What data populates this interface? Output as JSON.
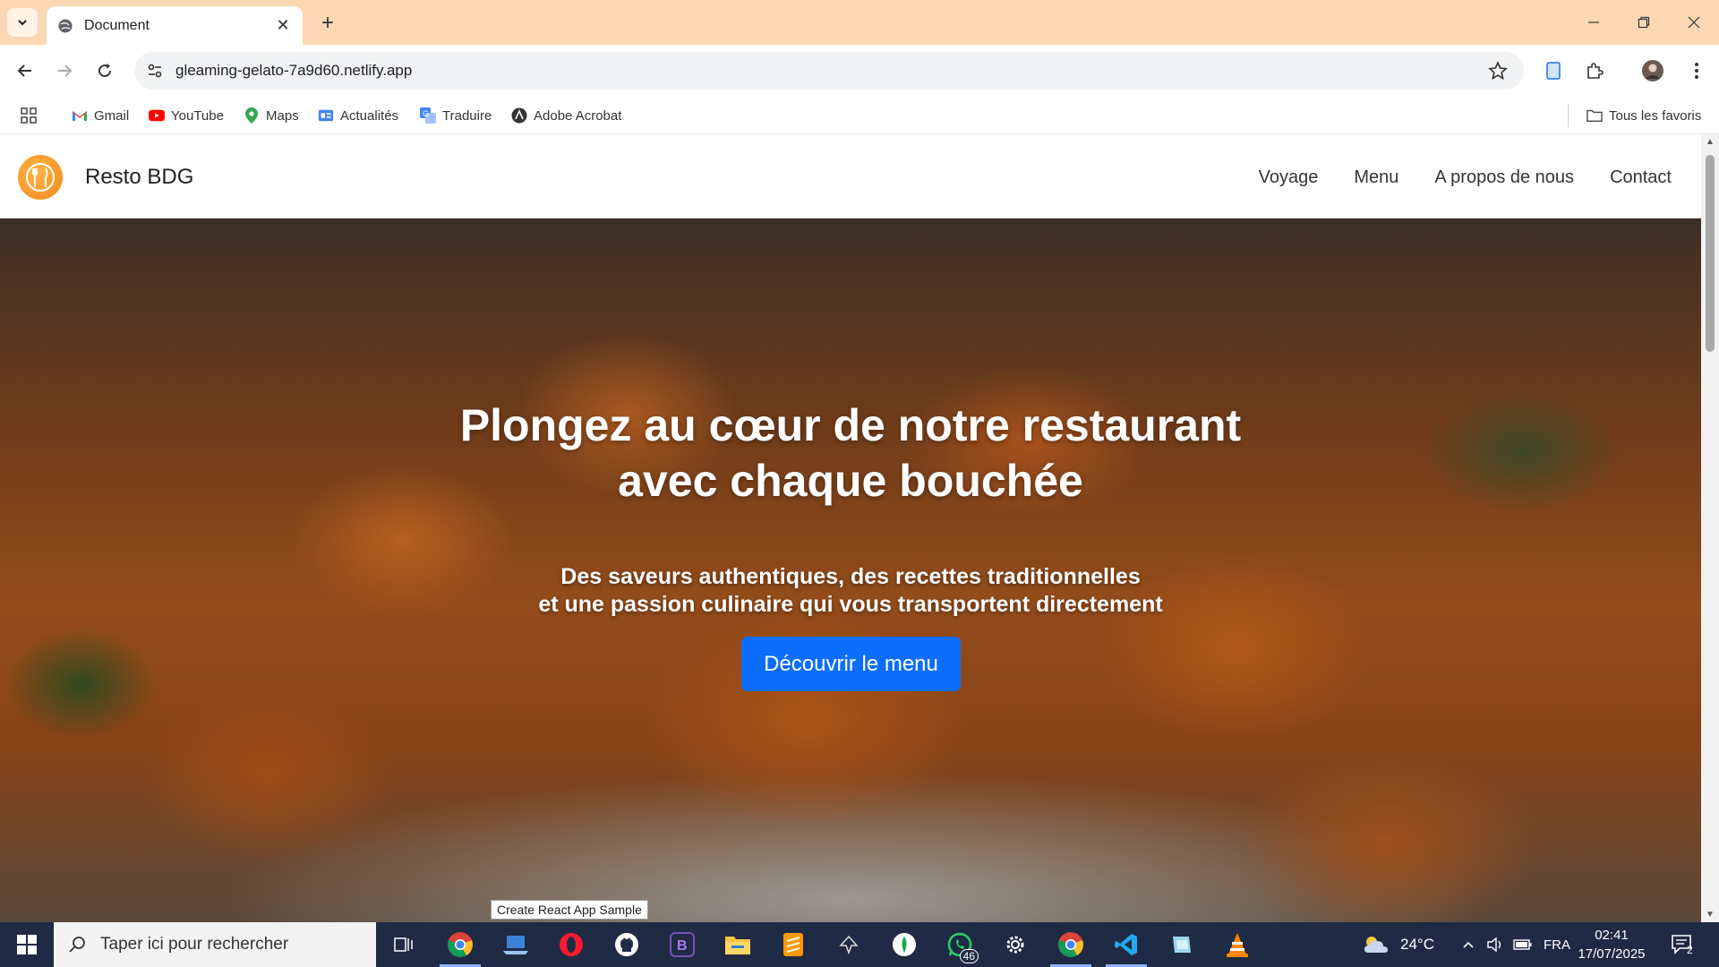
{
  "browser": {
    "tab_title": "Document",
    "url": "gleaming-gelato-7a9d60.netlify.app",
    "bookmarks": [
      {
        "label": "Gmail",
        "icon": "gmail-icon"
      },
      {
        "label": "YouTube",
        "icon": "youtube-icon"
      },
      {
        "label": "Maps",
        "icon": "maps-icon"
      },
      {
        "label": "Actualités",
        "icon": "news-icon"
      },
      {
        "label": "Traduire",
        "icon": "translate-icon"
      },
      {
        "label": "Adobe Acrobat",
        "icon": "acrobat-icon"
      }
    ],
    "all_bookmarks": "Tous les favoris",
    "colors": {
      "tabbar": "#fbd7b3",
      "omnibox": "#f1f3f4"
    }
  },
  "site": {
    "brand": "Resto BDG",
    "nav": [
      "Voyage",
      "Menu",
      "A propos de nous",
      "Contact"
    ],
    "hero": {
      "title_line1": "Plongez au cœur de notre restaurant",
      "title_line2": "avec chaque bouchée",
      "subtitle_line1": "Des saveurs authentiques, des recettes traditionnelles",
      "subtitle_line2": "et une passion culinaire qui vous transportent directement",
      "cta": "Découvrir le menu"
    },
    "colors": {
      "cta": "#0d6efd",
      "logo": "#f08a1b"
    }
  },
  "tooltip": "Create React App Sample",
  "taskbar": {
    "search_placeholder": "Taper ici pour rechercher",
    "whatsapp_badge": "46",
    "weather": "24°C",
    "language": "FRA",
    "time": "02:41",
    "date": "17/07/2025",
    "notifications": "2"
  }
}
